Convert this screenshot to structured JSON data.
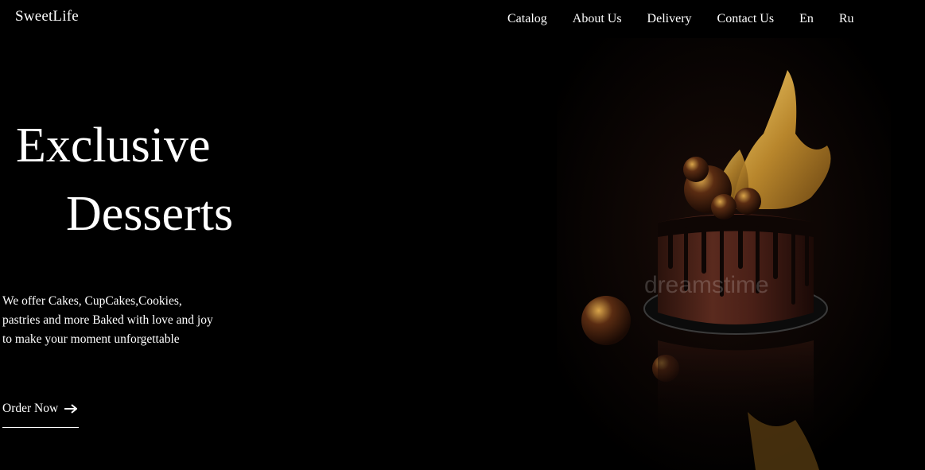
{
  "header": {
    "logo": "SweetLife",
    "nav": [
      "Catalog",
      "About Us",
      "Delivery",
      "Contact Us",
      "En",
      "Ru"
    ]
  },
  "hero": {
    "title_line1": "Exclusive",
    "title_line2": "Desserts",
    "description": "We offer Cakes, CupCakes,Cookies, pastries and more Baked with love and joy to make your moment unforgettable",
    "cta": "Order Now"
  },
  "image": {
    "watermark": "dreamstime"
  },
  "colors": {
    "background": "#000000",
    "text": "#ffffff",
    "gold": "#c89a3a",
    "chocolate": "#3a1a12"
  },
  "icons": {
    "cta_arrow": "arrow-right-icon"
  }
}
